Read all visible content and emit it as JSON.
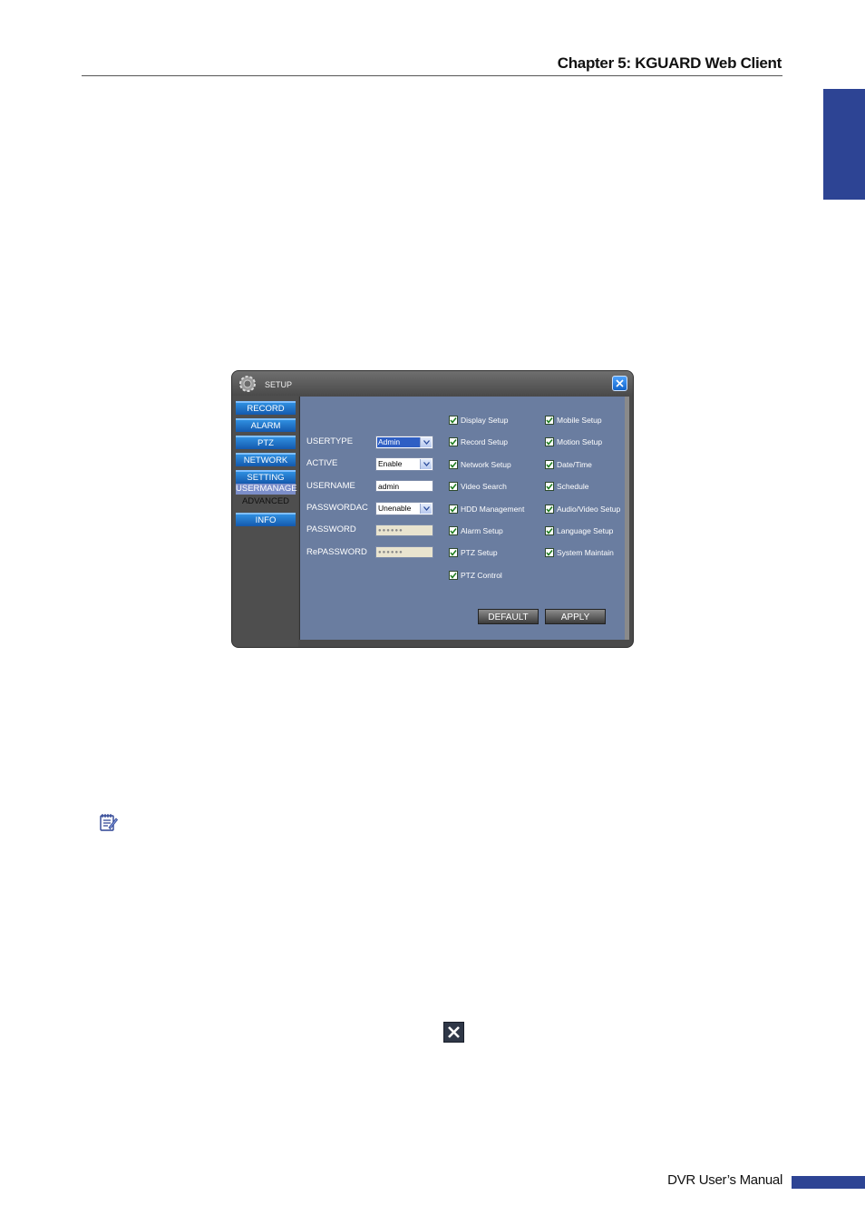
{
  "header": {
    "chapter": "Chapter 5: KGUARD Web Client"
  },
  "footer": {
    "manual": "DVR User’s Manual"
  },
  "setup_window": {
    "title": "SETUP",
    "nav": [
      "RECORD",
      "ALARM",
      "PTZ",
      "NETWORK",
      "SETTING",
      "USERMANAGE",
      "ADVANCED",
      "INFO"
    ],
    "active_nav": "USERMANAGE",
    "fields": {
      "usertype": {
        "label": "USERTYPE",
        "value": "Admin"
      },
      "active": {
        "label": "ACTIVE",
        "value": "Enable"
      },
      "username": {
        "label": "USERNAME",
        "value": "admin"
      },
      "passwordac": {
        "label": "PASSWORDAC",
        "value": "Unenable"
      },
      "password": {
        "label": "PASSWORD",
        "value": "●●●●●●"
      },
      "repassword": {
        "label": "RePASSWORD",
        "value": "●●●●●●"
      }
    },
    "permissions_left": [
      "Display Setup",
      "Record Setup",
      "Network Setup",
      "Video Search",
      "HDD Management",
      "Alarm Setup",
      "PTZ Setup",
      "PTZ Control"
    ],
    "permissions_right": [
      "Mobile Setup",
      "Motion Setup",
      "Date/Time",
      "Schedule",
      "Audio/Video Setup",
      "Language Setup",
      "System Maintain"
    ],
    "buttons": {
      "default": "DEFAULT",
      "apply": "APPLY"
    }
  },
  "colors": {
    "accent": "#2d4494",
    "panel": "#6a7da0",
    "nav_button": "#1e73c9"
  },
  "icons": {
    "note": "notepad-icon",
    "close_reference": "close-x-icon",
    "gear": "gear-icon"
  }
}
